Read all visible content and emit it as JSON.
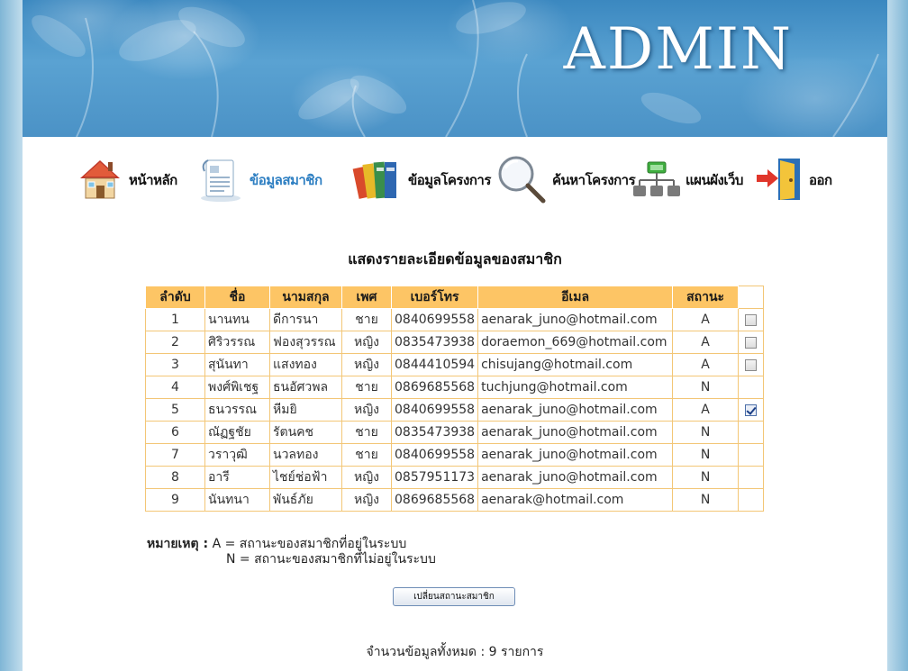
{
  "banner": {
    "title": "ADMIN"
  },
  "nav": {
    "items": [
      {
        "label": "หน้าหลัก",
        "icon": "house-icon"
      },
      {
        "label": "ข้อมูลสมาชิก",
        "icon": "document-icon"
      },
      {
        "label": "ข้อมูลโครงการ",
        "icon": "binders-icon"
      },
      {
        "label": "ค้นหาโครงการ",
        "icon": "magnifier-icon"
      },
      {
        "label": "แผนผังเว็บ",
        "icon": "sitemap-icon"
      },
      {
        "label": "ออก",
        "icon": "exit-door-icon"
      }
    ]
  },
  "section_title": "แสดงรายละเอียดข้อมูลของสมาชิก",
  "table": {
    "headers": [
      "ลำดับ",
      "ชื่อ",
      "นามสกุล",
      "เพศ",
      "เบอร์โทร",
      "อีเมล",
      "สถานะ"
    ],
    "rows": [
      {
        "no": "1",
        "first": "นานทน",
        "last": "ดีการนา",
        "sex": "ชาย",
        "phone": "0840699558",
        "email": "aenarak_juno@hotmail.com",
        "status": "A",
        "checkbox": true,
        "checked": false
      },
      {
        "no": "2",
        "first": "ศิริวรรณ",
        "last": "ฟองสุวรรณ",
        "sex": "หญิง",
        "phone": "0835473938",
        "email": "doraemon_669@hotmail.com",
        "status": "A",
        "checkbox": true,
        "checked": false
      },
      {
        "no": "3",
        "first": "สุนันทา",
        "last": "แสงทอง",
        "sex": "หญิง",
        "phone": "0844410594",
        "email": "chisujang@hotmail.com",
        "status": "A",
        "checkbox": true,
        "checked": false
      },
      {
        "no": "4",
        "first": "พงศ์พิเชฐ",
        "last": "ธนอัศวพล",
        "sex": "ชาย",
        "phone": "0869685568",
        "email": "tuchjung@hotmail.com",
        "status": "N",
        "checkbox": false,
        "checked": false
      },
      {
        "no": "5",
        "first": "ธนวรรณ",
        "last": "หีมยิ",
        "sex": "หญิง",
        "phone": "0840699558",
        "email": "aenarak_juno@hotmail.com",
        "status": "A",
        "checkbox": true,
        "checked": true
      },
      {
        "no": "6",
        "first": "ณัฏฐชัย",
        "last": "รัตนคช",
        "sex": "ชาย",
        "phone": "0835473938",
        "email": "aenarak_juno@hotmail.com",
        "status": "N",
        "checkbox": false,
        "checked": false
      },
      {
        "no": "7",
        "first": "วราวุฒิ",
        "last": "นวลทอง",
        "sex": "ชาย",
        "phone": "0840699558",
        "email": "aenarak_juno@hotmail.com",
        "status": "N",
        "checkbox": false,
        "checked": false
      },
      {
        "no": "8",
        "first": "อารี",
        "last": "ไชย์ช่อฟ้า",
        "sex": "หญิง",
        "phone": "0857951173",
        "email": "aenarak_juno@hotmail.com",
        "status": "N",
        "checkbox": false,
        "checked": false
      },
      {
        "no": "9",
        "first": "นันทนา",
        "last": "พันธ์ภัย",
        "sex": "หญิง",
        "phone": "0869685568",
        "email": "aenarak@hotmail.com",
        "status": "N",
        "checkbox": false,
        "checked": false
      }
    ]
  },
  "note": {
    "label": "หมายเหตุ :",
    "line1": "A = สถานะของสมาชิกที่อยู่ในระบบ",
    "line2": "N = สถานะของสมาชิกที่ไม่อยู่ในระบบ"
  },
  "change_button": "เปลี่ยนสถานะสมาชิก",
  "total": "จำนวนข้อมูลทั้งหมด : 9 รายการ"
}
